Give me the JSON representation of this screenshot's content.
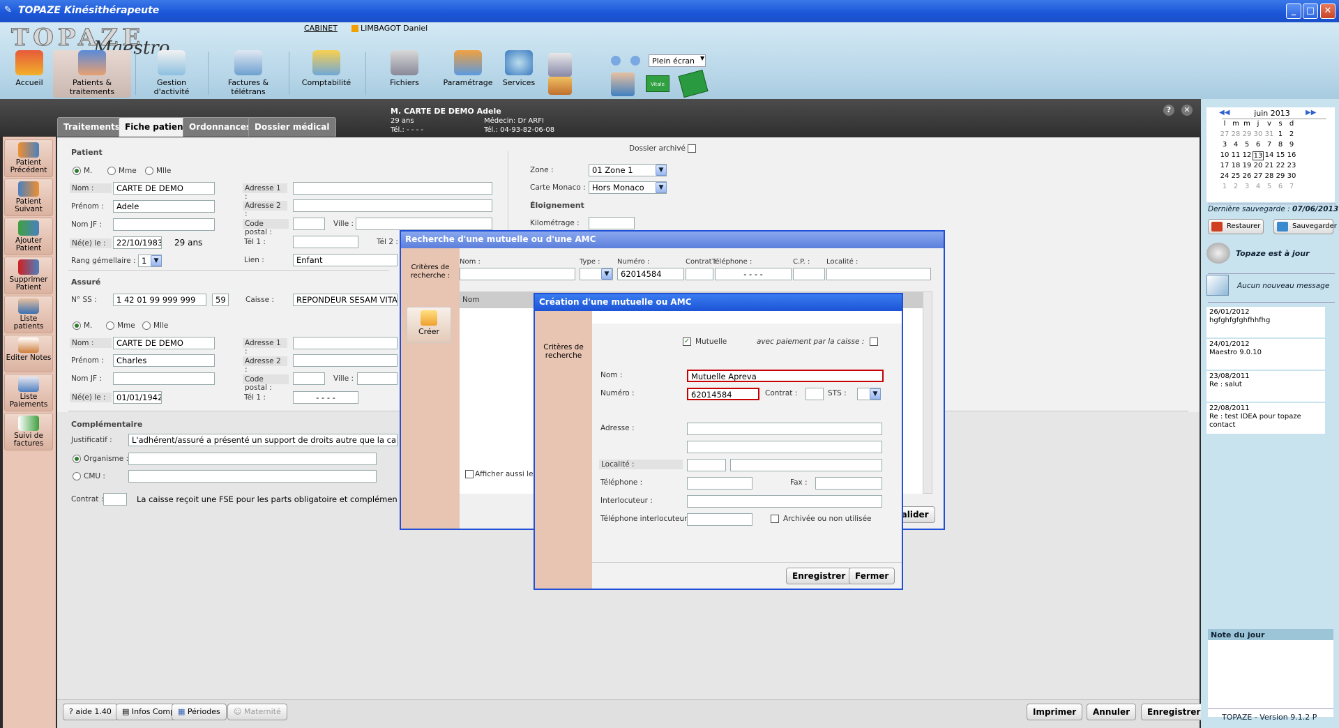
{
  "window": {
    "title": "TOPAZE  Kinésithérapeute"
  },
  "header": {
    "logo_main": "TOPAZE",
    "logo_sub": "Maestro",
    "cabinet_label": "CABINET",
    "practitioner": "LIMBAGOT Daniel",
    "nav": [
      "Accueil",
      "Patients & traitements",
      "Gestion d'activité",
      "Factures & télétrans",
      "Comptabilité",
      "Fichiers",
      "Paramétrage",
      "Services"
    ],
    "plein_ecran": "Plein écran",
    "vitale_label": "Vitale"
  },
  "patient_header": {
    "name": "M. CARTE DE DEMO Adele",
    "age": "29 ans",
    "tel": "Tél.:  - - - -",
    "medecin": "Médecin: Dr ARFI",
    "tel2": "Tél.: 04-93-82-06-08"
  },
  "tabs": [
    "Traitements",
    "Fiche patient",
    "Ordonnances",
    "Dossier médical"
  ],
  "sidebar": [
    "Patient Précédent",
    "Patient Suivant",
    "Ajouter Patient",
    "Supprimer Patient",
    "Liste patients",
    "Editer Notes",
    "Liste Paiements",
    "Suivi de factures"
  ],
  "patient": {
    "section": "Patient",
    "civ": [
      "M.",
      "Mme",
      "Mlle"
    ],
    "nom_label": "Nom :",
    "nom": "CARTE DE DEMO",
    "prenom_label": "Prénom :",
    "prenom": "Adele",
    "nomjf_label": "Nom JF :",
    "ne_label": "Né(e) le :",
    "ne": "22/10/1983",
    "age": "29 ans",
    "rang_label": "Rang gémellaire :",
    "rang": "1",
    "adresse1": "Adresse 1 :",
    "adresse2": "Adresse 2 :",
    "cp": "Code postal :",
    "ville": "Ville :",
    "tel1": "Tél 1 :",
    "tel2": "Tél 2 :",
    "lien_label": "Lien :",
    "lien": "Enfant",
    "dossier_archive": "Dossier archivé",
    "zone_label": "Zone :",
    "zone": "01   Zone 1",
    "monaco_label": "Carte Monaco :",
    "monaco": "Hors Monaco",
    "eloignement": "Éloignement",
    "km_label": "Kilométrage :"
  },
  "assure": {
    "section": "Assuré",
    "nss_label": "N° SS :",
    "nss": "1 42 01 99 999 999",
    "nss_key": "59",
    "caisse_label": "Caisse :",
    "caisse": "REPONDEUR SESAM VITA",
    "civ": [
      "M.",
      "Mme",
      "Mlle"
    ],
    "nom": "CARTE DE DEMO",
    "prenom": "Charles",
    "ne": "01/01/1942",
    "tel": "- - - -"
  },
  "complementaire": {
    "section": "Complémentaire",
    "justificatif_label": "Justificatif :",
    "justificatif": "L'adhérent/assuré a présenté un support de droits autre que la carte V",
    "organisme": "Organisme :",
    "cmu": "CMU :",
    "contrat_label": "Contrat :",
    "contrat_text": "La caisse reçoit une FSE pour les parts obligatoire et complémentair"
  },
  "bottom": {
    "aide": "aide 1.40",
    "infos": "Infos Comp.",
    "periodes": "Périodes",
    "maternite": "Maternité",
    "imprimer": "Imprimer",
    "annuler": "Annuler",
    "enregistrer": "Enregistrer"
  },
  "right_panel": {
    "month": "juin 2013",
    "days": [
      "l",
      "m",
      "m",
      "j",
      "v",
      "s",
      "d"
    ],
    "weeks": [
      [
        "27",
        "28",
        "29",
        "30",
        "31",
        "1",
        "2"
      ],
      [
        "3",
        "4",
        "5",
        "6",
        "7",
        "8",
        "9"
      ],
      [
        "10",
        "11",
        "12",
        "13",
        "14",
        "15",
        "16"
      ],
      [
        "17",
        "18",
        "19",
        "20",
        "21",
        "22",
        "23"
      ],
      [
        "24",
        "25",
        "26",
        "27",
        "28",
        "29",
        "30"
      ],
      [
        "1",
        "2",
        "3",
        "4",
        "5",
        "6",
        "7"
      ]
    ],
    "last_save_label": "Dernière sauvegarde :",
    "last_save": "07/06/2013",
    "restaurer": "Restaurer",
    "sauvegarder": "Sauvegarder",
    "uptodate": "Topaze est à jour",
    "no_message": "Aucun nouveau message",
    "messages": [
      {
        "date": "26/01/2012",
        "text": "hgfghfgfghfhhfhg"
      },
      {
        "date": "24/01/2012",
        "text": "Maestro 9.0.10"
      },
      {
        "date": "23/08/2011",
        "text": "Re : salut"
      },
      {
        "date": "22/08/2011",
        "text": "Re : test IDEA pour topaze contact"
      }
    ],
    "note_du_jour": "Note du jour",
    "version": "TOPAZE - Version 9.1.2 P"
  },
  "search_dialog": {
    "title": "Recherche d'une mutuelle ou d'une AMC",
    "criteres": "Critères de recherche :",
    "creer": "Créer",
    "cols": {
      "nom": "Nom :",
      "type": "Type :",
      "numero": "Numéro :",
      "contrat": "Contrat :",
      "telephone": "Téléphone :",
      "cp": "C.P. :",
      "localite": "Localité :"
    },
    "numero": "62014584",
    "telephone": "- - - -",
    "list_header": "Nom",
    "afficher": "Afficher aussi les",
    "valider": "Valider"
  },
  "create_dialog": {
    "title": "Création d'une mutuelle ou AMC",
    "criteres": "Critères de recherche",
    "mutuelle": "Mutuelle",
    "paiement": "avec paiement par la caisse :",
    "nom_label": "Nom :",
    "nom": "Mutuelle Apreva",
    "numero_label": "Numéro :",
    "numero": "62014584",
    "contrat_label": "Contrat :",
    "sts_label": "STS :",
    "adresse_label": "Adresse :",
    "localite_label": "Localité :",
    "telephone_label": "Téléphone :",
    "fax_label": "Fax :",
    "interlocuteur_label": "Interlocuteur :",
    "tel_interlocuteur_label": "Téléphone interlocuteur :",
    "archivee": "Archivée ou non utilisée",
    "enregistrer": "Enregistrer",
    "fermer": "Fermer"
  }
}
